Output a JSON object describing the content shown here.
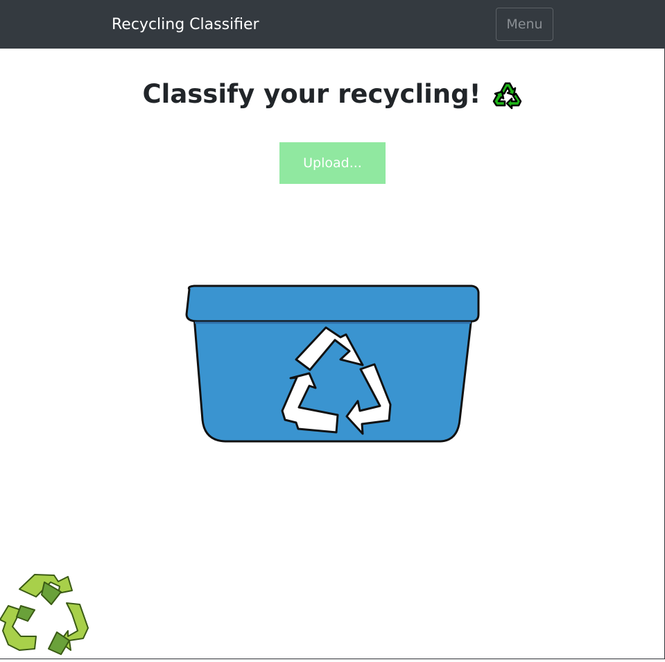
{
  "navbar": {
    "brand": "Recycling Classifier",
    "menu_label": "Menu"
  },
  "main": {
    "title": "Classify your recycling!",
    "title_icon": "recycling-symbol-icon",
    "upload_label": "Upload..."
  },
  "illustration": {
    "bin_icon": "recycling-bin-icon",
    "bin_color": "#3a94d0",
    "corner_icon": "recycling-logo-icon",
    "corner_color": "#8cc63f"
  },
  "colors": {
    "navbar_bg": "#343a40",
    "upload_bg": "#90e8a0",
    "emoji_green": "#1fb518"
  }
}
